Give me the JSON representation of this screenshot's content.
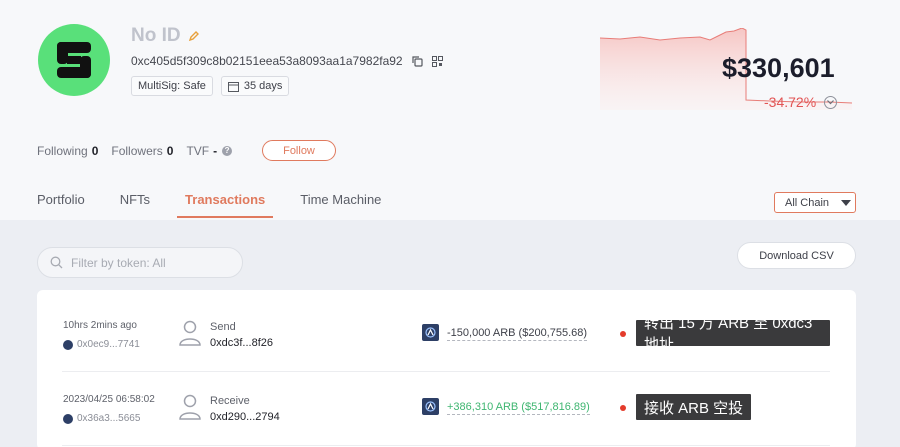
{
  "profile": {
    "name": "No ID",
    "address": "0xc405d5f309c8b02151eea53a8093aa1a7982fa92",
    "tags": [
      {
        "label": "MultiSig: Safe"
      },
      {
        "label": "35 days"
      }
    ],
    "balance": "$330,601",
    "change": "-34.72%",
    "accent_color": "#e07a5e",
    "negative_color": "#e25454",
    "avatar_color": "#59e07a"
  },
  "stats": {
    "following_label": "Following",
    "following_value": "0",
    "followers_label": "Followers",
    "followers_value": "0",
    "tvf_label": "TVF",
    "tvf_value": "-",
    "follow_button": "Follow"
  },
  "tabs": [
    {
      "label": "Portfolio"
    },
    {
      "label": "NFTs"
    },
    {
      "label": "Transactions"
    },
    {
      "label": "Time Machine"
    }
  ],
  "chain_select": {
    "selected": "All Chain"
  },
  "search": {
    "placeholder": "Filter by token: All"
  },
  "download_button": "Download CSV",
  "transactions": [
    {
      "time": "10hrs 2mins ago",
      "from": "0x0ec9...7741",
      "type": "Send",
      "to": "0xdc3f...8f26",
      "amount": "-150,000 ARB ($200,755.68)",
      "direction": "negative",
      "annotation": "转出 15 万 ARB 至 0xdc3 地址"
    },
    {
      "time": "2023/04/25 06:58:02",
      "from": "0x36a3...5665",
      "type": "Receive",
      "to": "0xd290...2794",
      "amount": "+386,310 ARB ($517,816.89)",
      "direction": "positive",
      "annotation": "接收 ARB 空投"
    }
  ]
}
